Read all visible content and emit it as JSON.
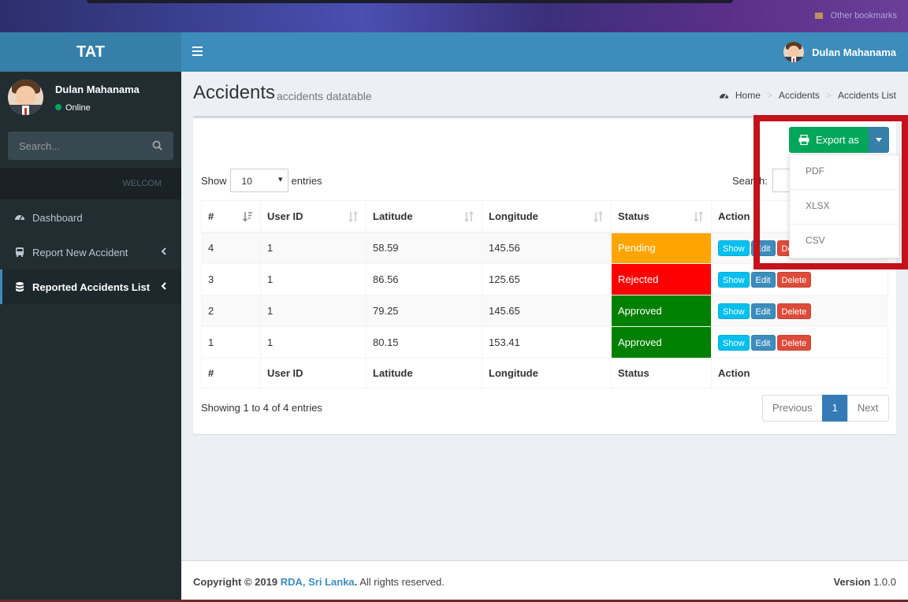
{
  "browser": {
    "bookmark_label": "Other bookmarks"
  },
  "app": {
    "logo": "TAT"
  },
  "header": {
    "user_name": "Dulan Mahanama"
  },
  "sidebar": {
    "user_name": "Dulan Mahanama",
    "status": "Online",
    "search_placeholder": "Search...",
    "section_header": "WELCOM",
    "items": [
      {
        "label": "Dashboard",
        "icon": "dashboard-icon"
      },
      {
        "label": "Report New Accident",
        "icon": "bus-icon"
      },
      {
        "label": "Reported Accidents List",
        "icon": "database-icon"
      }
    ]
  },
  "page": {
    "title": "Accidents",
    "subtitle": "accidents datatable"
  },
  "breadcrumb": [
    "Home",
    "Accidents",
    "Accidents List"
  ],
  "datatable": {
    "show_label": "Show",
    "entries_label": "entries",
    "length_value": "10",
    "search_label": "Search:",
    "columns": [
      "#",
      "User ID",
      "Latitude",
      "Longitude",
      "Status",
      "Action"
    ],
    "rows": [
      {
        "id": "4",
        "user_id": "1",
        "lat": "58.59",
        "lon": "145.56",
        "status": "Pending",
        "status_color": "#ffa500"
      },
      {
        "id": "3",
        "user_id": "1",
        "lat": "86.56",
        "lon": "125.65",
        "status": "Rejected",
        "status_color": "#ff0000"
      },
      {
        "id": "2",
        "user_id": "1",
        "lat": "79.25",
        "lon": "145.65",
        "status": "Approved",
        "status_color": "#008000"
      },
      {
        "id": "1",
        "user_id": "1",
        "lat": "80.15",
        "lon": "153.41",
        "status": "Approved",
        "status_color": "#008000"
      }
    ],
    "action_labels": {
      "show": "Show",
      "edit": "Edit",
      "delete": "Delete"
    },
    "info": "Showing 1 to 4 of 4 entries",
    "pagination": {
      "previous": "Previous",
      "current": "1",
      "next": "Next"
    }
  },
  "export": {
    "label": "Export as",
    "options": [
      "PDF",
      "XLSX",
      "CSV"
    ]
  },
  "footer": {
    "copyright": "Copyright © 2019",
    "brand": "RDA, Sri Lanka",
    "rights": "All rights reserved.",
    "version_label": "Version",
    "version_value": "1.0.0"
  }
}
